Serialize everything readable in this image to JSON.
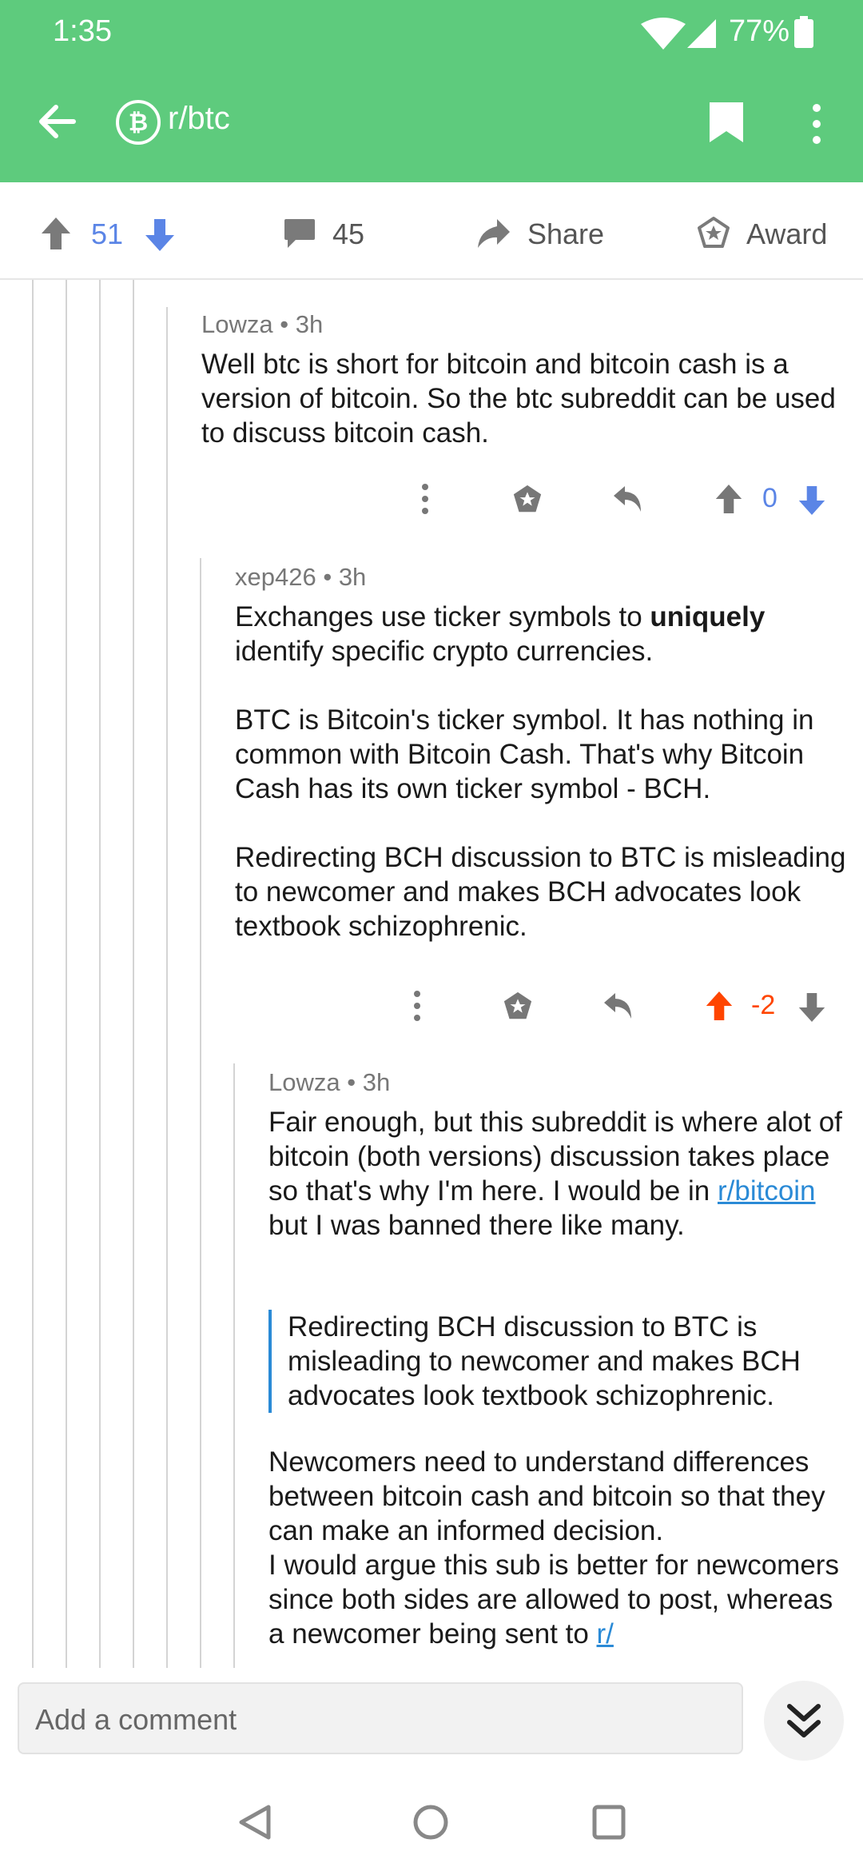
{
  "status_bar": {
    "time": "1:35",
    "battery": "77%"
  },
  "app_bar": {
    "subreddit": "r/btc"
  },
  "post_actions": {
    "upvotes": "51",
    "comments": "45",
    "share": "Share",
    "award": "Award"
  },
  "comments": [
    {
      "author": "Lowza",
      "age": "3h",
      "text": "Well btc is short for bitcoin and bitcoin cash is a version of bitcoin. So the btc subreddit can be used to discuss bitcoin cash.",
      "score": "0"
    },
    {
      "author": "xep426",
      "age": "3h",
      "p1_before": "Exchanges use ticker symbols to ",
      "p1_bold": "uniquely",
      "p1_after": " identify specific crypto currencies.",
      "p2": "BTC is Bitcoin's ticker symbol. It has nothing in common with Bitcoin Cash. That's why Bitcoin Cash has its own ticker symbol - BCH.",
      "p3": "Redirecting BCH discussion to BTC is misleading to newcomer and makes BCH advocates look textbook schizophrenic.",
      "score": "-2"
    },
    {
      "author": "Lowza",
      "age": "3h",
      "p1_before": "Fair enough, but this subreddit is where alot of bitcoin (both versions) discussion takes place so that's why I'm here. I would be in ",
      "p1_link": "r/bitcoin",
      "p1_after": " but I was banned there like many.",
      "quote": "Redirecting BCH discussion to BTC is misleading to newcomer and makes BCH advocates look textbook schizophrenic.",
      "p2": "Newcomers need to understand differences between bitcoin cash and bitcoin so that they can make an informed decision.",
      "p3_before": "I would argue this sub is better for newcomers since both sides are allowed to post, whereas a newcomer being sent to ",
      "p3_link": "r/"
    }
  ],
  "composer": {
    "placeholder": "Add a comment"
  },
  "colors": {
    "app_bar": "#5ecb7d",
    "upvote_active": "#ff4500",
    "vote_blue": "#5b85e6",
    "link": "#2a8ad6"
  }
}
